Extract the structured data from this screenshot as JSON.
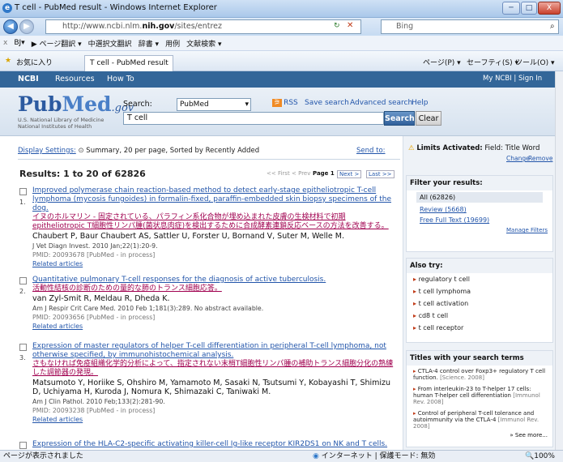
{
  "window": {
    "title": "T cell - PubMed result - Windows Internet Explorer",
    "minimize": "─",
    "maximize": "□",
    "close": "X"
  },
  "address": {
    "url_prefix": "http://www.ncbi.nlm.",
    "url_host": "nih.gov",
    "url_path": "/sites/entrez",
    "search_engine": "Bing"
  },
  "toolbar": {
    "items": [
      "BJ▾",
      "▶ ページ翻訳 ▾",
      "中選択文翻訳",
      "辞書 ▾",
      "用例",
      "文献検索 ▾"
    ]
  },
  "favorites": {
    "label": "お気に入り",
    "tab": "T cell - PubMed result",
    "menu_page": "ページ(P) ▾",
    "menu_safety": "セーフティ(S) ▾",
    "menu_tools": "ツール(O) ▾"
  },
  "ncbi_bar": {
    "logo": "NCBI",
    "resources": "Resources",
    "howto": "How To",
    "myncbi": "My NCBI | Sign In"
  },
  "header": {
    "logo_pub": "Pub",
    "logo_med": "Med",
    "logo_gov": ".gov",
    "lib1": "U.S. National Library of Medicine",
    "lib2": "National Institutes of Health",
    "search_label": "Search:",
    "db": "PubMed",
    "rss": "RSS",
    "save_search": "Save search",
    "advanced": "Advanced search",
    "help": "Help",
    "term": "T cell",
    "search_btn": "Search",
    "clear_btn": "Clear"
  },
  "results": {
    "display_settings": "Display Settings:",
    "summary": "Summary, 20 per page, Sorted by Recently Added",
    "send_to": "Send to:",
    "count": "Results: 1 to 20 of 62826",
    "first": "<< First",
    "prev": "< Prev",
    "page": "Page 1",
    "next": "Next >",
    "last": "Last >>"
  },
  "items": [
    {
      "num": "1.",
      "title": "Improved polymerase chain reaction-based method to detect early-stage epitheliotropic T-cell lymphoma (mycosis fungoides) in formalin-fixed, paraffin-embedded skin biopsy specimens of the dog.",
      "jp": "イヌのホルマリン - 固定されている、パラフィン系化合物が埋め込まれた皮膚の生検材料で初期 epitheliotropic T細胞性リンパ腫(菌状息肉症)を検出するために合成酵素連鎖反応ベースの方法を改善する。",
      "authors": "Chaubert P, Baur Chaubert AS, Sattler U, Forster U, Bornand V, Suter M, Welle M.",
      "journal": "J Vet Diagn Invest. 2010 Jan;22(1):20-9.",
      "pmid": "PMID: 20093678 [PubMed - in process]",
      "related": "Related articles"
    },
    {
      "num": "2.",
      "title": "Quantitative pulmonary T-cell responses for the diagnosis of active tuberculosis.",
      "jp": "活動性結核の診断のための量的な肺のトランス細胞応答。",
      "authors": "van Zyl-Smit R, Meldau R, Dheda K.",
      "journal": "Am J Respir Crit Care Med. 2010 Feb 1;181(3):289. No abstract available.",
      "pmid": "PMID: 20093656 [PubMed - in process]",
      "related": "Related articles"
    },
    {
      "num": "3.",
      "title": "Expression of master regulators of helper T-cell differentiation in peripheral T-cell lymphoma, not otherwise specified, by immunohistochemical analysis.",
      "jp": "さもなければ免疫組織化学的分析によって、指定されない末梢T細胞性リンパ腫の補助トランス細胞分化の熟練した調節器の発現。",
      "authors": "Matsumoto Y, Horiike S, Ohshiro M, Yamamoto M, Sasaki N, Tsutsumi Y, Kobayashi T, Shimizu D, Uchiyama H, Kuroda J, Nomura K, Shimazaki C, Taniwaki M.",
      "journal": "Am J Clin Pathol. 2010 Feb;133(2):281-90.",
      "pmid": "PMID: 20093238 [PubMed - in process]",
      "related": "Related articles"
    },
    {
      "num": "",
      "title": "Expression of the HLA-C2-specific activating killer-cell Ig-like receptor KIR2DS1 on NK and T cells.",
      "jp": "",
      "authors": "",
      "journal": "",
      "pmid": "",
      "related": ""
    }
  ],
  "limits": {
    "title": "Limits Activated:",
    "field": "Field: Title Word",
    "change": "Change",
    "remove": "Remove"
  },
  "filter": {
    "title": "Filter your results:",
    "all": "All (62826)",
    "review": "Review (5668)",
    "free": "Free Full Text (19699)",
    "manage": "Manage Filters"
  },
  "also_try": {
    "title": "Also try:",
    "items": [
      "regulatory t cell",
      "t cell lymphoma",
      "t cell activation",
      "cd8 t cell",
      "t cell receptor"
    ]
  },
  "titles": {
    "title": "Titles with your search terms",
    "items": [
      {
        "text": "CTLA-4 control over Foxp3+ regulatory T cell function.",
        "src": "[Science. 2008]"
      },
      {
        "text": "From interleukin-23 to T-helper 17 cells: human T-helper cell differentiation",
        "src": "[Immunol Rev. 2008]"
      },
      {
        "text": "Control of peripheral T-cell tolerance and autoimmunity via the CTLA-4",
        "src": "[Immunol Rev. 2008]"
      }
    ],
    "more": "» See more..."
  },
  "status": {
    "left": "ページが表示されました",
    "zone": "インターネット | 保護モード: 無効",
    "zoom": "100%"
  }
}
